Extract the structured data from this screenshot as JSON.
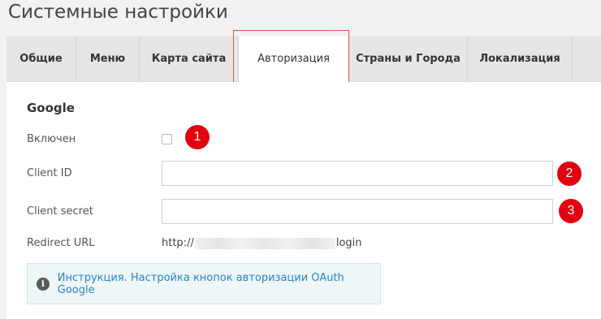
{
  "page": {
    "title": "Системные настройки"
  },
  "tabs": [
    {
      "label": "Общие",
      "active": false
    },
    {
      "label": "Меню",
      "active": false
    },
    {
      "label": "Карта сайта",
      "active": false
    },
    {
      "label": "Авторизация",
      "active": true
    },
    {
      "label": "Страны и Города",
      "active": false
    },
    {
      "label": "Локализация",
      "active": false
    }
  ],
  "section": {
    "title": "Google"
  },
  "fields": {
    "enabled": {
      "label": "Включен",
      "checked": false
    },
    "client_id": {
      "label": "Client ID",
      "value": ""
    },
    "client_secret": {
      "label": "Client secret",
      "value": ""
    },
    "redirect_url": {
      "label": "Redirect URL",
      "prefix": "http://",
      "suffix": "login"
    }
  },
  "annotations": {
    "badge1": "1",
    "badge2": "2",
    "badge3": "3",
    "color": "#e3000f"
  },
  "info": {
    "icon": "info-icon",
    "link_text": "Инструкция. Настройка кнопок авторизации OAuth Google"
  }
}
